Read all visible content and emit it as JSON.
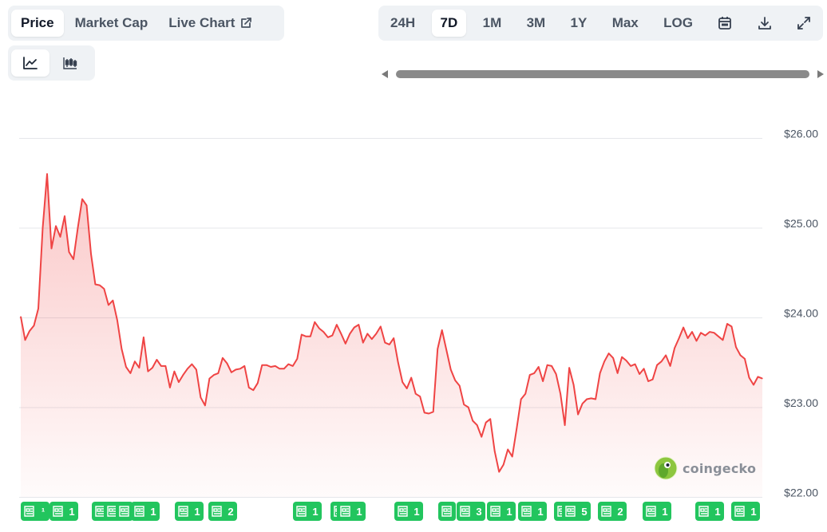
{
  "tabs": [
    {
      "label": "Price",
      "active": true
    },
    {
      "label": "Market Cap",
      "active": false
    },
    {
      "label": "Live Chart",
      "active": false,
      "icon": "external-link-icon"
    }
  ],
  "chart_type_buttons": [
    {
      "icon": "line-chart-icon",
      "active": true
    },
    {
      "icon": "candlestick-chart-icon",
      "active": false
    }
  ],
  "ranges": [
    {
      "label": "24H",
      "active": false
    },
    {
      "label": "7D",
      "active": true
    },
    {
      "label": "1M",
      "active": false
    },
    {
      "label": "3M",
      "active": false
    },
    {
      "label": "1Y",
      "active": false
    },
    {
      "label": "Max",
      "active": false
    },
    {
      "label": "LOG",
      "active": false
    }
  ],
  "range_tools": [
    {
      "icon": "calendar-icon"
    },
    {
      "icon": "download-icon"
    },
    {
      "icon": "expand-icon"
    }
  ],
  "watermark": "coingecko",
  "colors": {
    "line": "#ef4444",
    "accent_green": "#22c55e",
    "grid": "#e5e7eb"
  },
  "chart_data": {
    "type": "area",
    "ylim": [
      21.95,
      26.3
    ],
    "y_ticks": [
      "$26.00",
      "$25.00",
      "$24.00",
      "$23.00",
      "$22.00"
    ],
    "y_tick_values": [
      26,
      25,
      24,
      23,
      22
    ],
    "grid": true,
    "series": [
      {
        "values": [
          23.96,
          23.7,
          23.8,
          23.86,
          24.05,
          24.95,
          25.55,
          24.72,
          24.97,
          24.85,
          25.08,
          24.68,
          24.6,
          24.95,
          25.27,
          25.2,
          24.66,
          24.32,
          24.31,
          24.27,
          24.09,
          24.14,
          23.92,
          23.6,
          23.4,
          23.33,
          23.46,
          23.39,
          23.73,
          23.35,
          23.39,
          23.48,
          23.41,
          23.41,
          23.17,
          23.35,
          23.23,
          23.31,
          23.38,
          23.43,
          23.37,
          23.06,
          22.97,
          23.27,
          23.31,
          23.33,
          23.5,
          23.44,
          23.34,
          23.37,
          23.38,
          23.41,
          23.17,
          23.14,
          23.22,
          23.42,
          23.42,
          23.4,
          23.41,
          23.38,
          23.38,
          23.43,
          23.41,
          23.49,
          23.76,
          23.74,
          23.74,
          23.9,
          23.83,
          23.79,
          23.73,
          23.75,
          23.87,
          23.77,
          23.66,
          23.77,
          23.84,
          23.87,
          23.67,
          23.77,
          23.71,
          23.77,
          23.85,
          23.67,
          23.65,
          23.72,
          23.45,
          23.23,
          23.16,
          23.28,
          23.1,
          23.07,
          22.89,
          22.88,
          22.9,
          23.6,
          23.81,
          23.59,
          23.37,
          23.25,
          23.19,
          22.98,
          22.95,
          22.8,
          22.75,
          22.62,
          22.78,
          22.82,
          22.46,
          22.23,
          22.31,
          22.48,
          22.4,
          22.71,
          23.04,
          23.1,
          23.31,
          23.33,
          23.4,
          23.24,
          23.42,
          23.41,
          23.32,
          23.1,
          22.75,
          23.39,
          23.2,
          22.87,
          22.99,
          23.04,
          23.05,
          23.04,
          23.33,
          23.46,
          23.55,
          23.5,
          23.33,
          23.51,
          23.47,
          23.41,
          23.43,
          23.32,
          23.38,
          23.24,
          23.26,
          23.42,
          23.46,
          23.53,
          23.41,
          23.61,
          23.72,
          23.84,
          23.72,
          23.79,
          23.69,
          23.78,
          23.75,
          23.79,
          23.78,
          23.74,
          23.7,
          23.88,
          23.85,
          23.62,
          23.53,
          23.49,
          23.28,
          23.2,
          23.29,
          23.27
        ]
      }
    ]
  },
  "news_badges": [
    {
      "label": "¹",
      "x": 44
    },
    {
      "label": "1",
      "x": 80
    },
    {
      "label": "",
      "x": 126
    },
    {
      "label": "",
      "x": 141
    },
    {
      "label": "",
      "x": 156
    },
    {
      "label": "1",
      "x": 182
    },
    {
      "label": "1",
      "x": 237
    },
    {
      "label": "2",
      "x": 279
    },
    {
      "label": "1",
      "x": 385
    },
    {
      "label": "",
      "x": 425
    },
    {
      "label": "1",
      "x": 440
    },
    {
      "label": "1",
      "x": 512
    },
    {
      "label": "",
      "x": 560
    },
    {
      "label": "3",
      "x": 590
    },
    {
      "label": "1",
      "x": 628
    },
    {
      "label": "1",
      "x": 667
    },
    {
      "label": "",
      "x": 705
    },
    {
      "label": "5",
      "x": 722
    },
    {
      "label": "2",
      "x": 767
    },
    {
      "label": "1",
      "x": 823
    },
    {
      "label": "1",
      "x": 889
    },
    {
      "label": "1",
      "x": 934
    }
  ]
}
